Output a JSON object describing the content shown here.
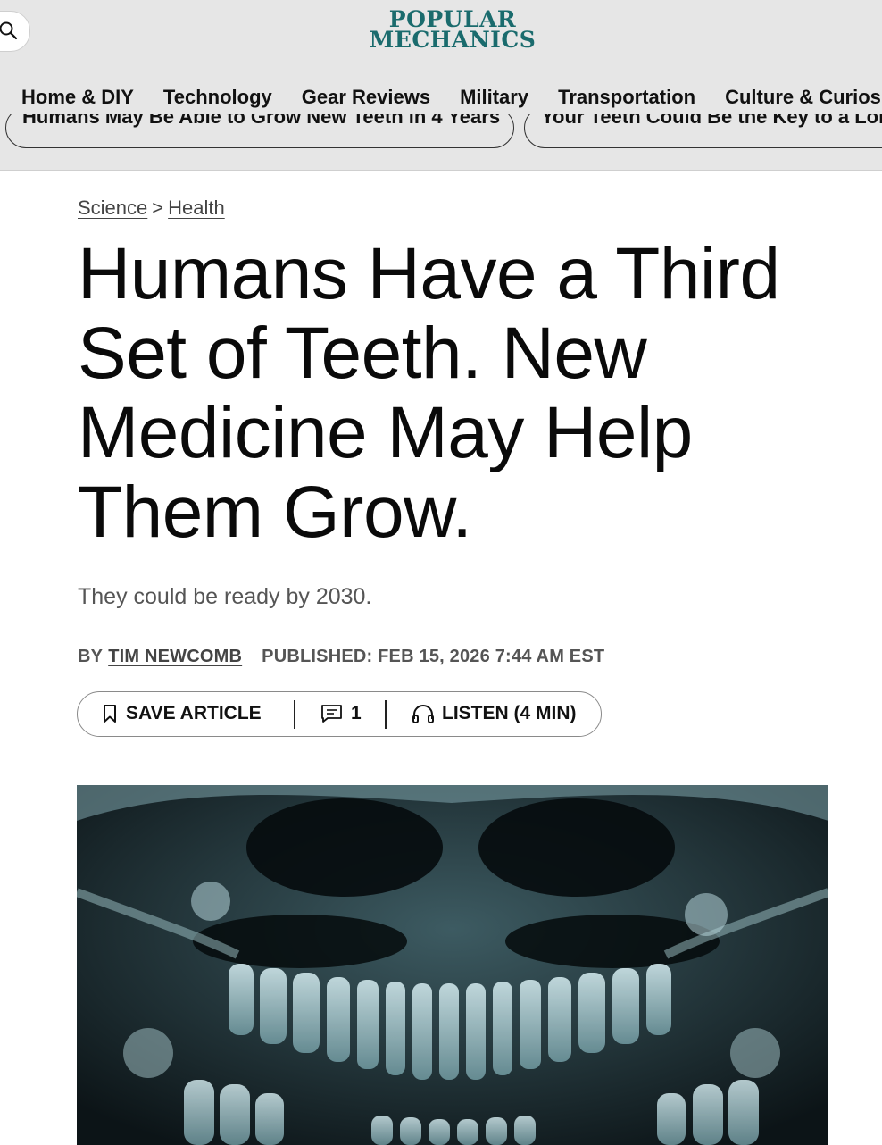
{
  "header": {
    "logo_line1": "POPULAR",
    "logo_line2": "MECHANICS",
    "logo_color": "#1a6b6d",
    "search_icon": "search-icon",
    "nav": [
      {
        "label": "Home & DIY"
      },
      {
        "label": "Technology"
      },
      {
        "label": "Gear Reviews"
      },
      {
        "label": "Military"
      },
      {
        "label": "Transportation"
      },
      {
        "label": "Culture & Curiosi"
      }
    ],
    "related_pills": [
      {
        "label": "Humans May Be Able to Grow New Teeth in 4 Years"
      },
      {
        "label": "Your Teeth Could Be the Key to a Lon"
      }
    ]
  },
  "article": {
    "breadcrumb": {
      "section": "Science",
      "separator": ">",
      "subsection": "Health"
    },
    "title": "Humans Have a Third Set of Teeth. New Medicine May Help Them Grow.",
    "dek": "They could be ready by 2030.",
    "byline": {
      "by": "BY",
      "author": "TIM NEWCOMB",
      "published": "PUBLISHED: FEB 15, 2026 7:44 AM EST"
    },
    "actions": {
      "save_label": "SAVE ARTICLE",
      "save_icon": "bookmark-icon",
      "comment_count": "1",
      "comment_icon": "comment-icon",
      "listen_label": "LISTEN (4 MIN)",
      "listen_icon": "headphones-icon"
    },
    "hero_image": {
      "subject": "dental-xray-image",
      "tint": "#7fa6ad"
    }
  }
}
